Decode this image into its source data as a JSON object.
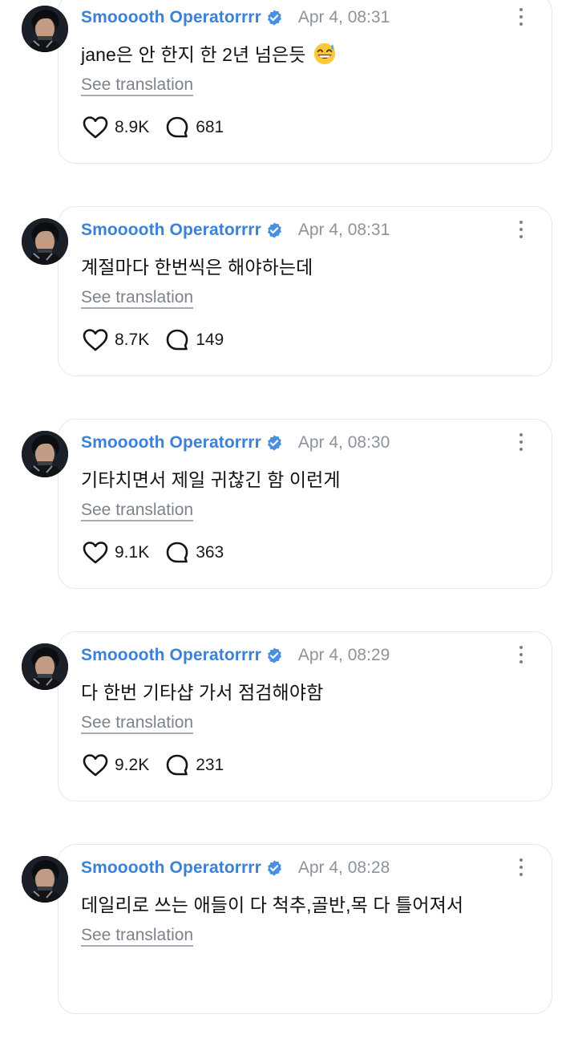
{
  "posts": [
    {
      "author": "Smooooth Operatorrrr",
      "timestamp": "Apr 4, 08:31",
      "text": "jane은 안 한지 한 2년 넘은듯",
      "emoji": "grinning-sweat-emoji",
      "translate_label": "See translation",
      "likes": "8.9K",
      "replies": "681"
    },
    {
      "author": "Smooooth Operatorrrr",
      "timestamp": "Apr 4, 08:31",
      "text": "계절마다 한번씩은 해야하는데",
      "translate_label": "See translation",
      "likes": "8.7K",
      "replies": "149"
    },
    {
      "author": "Smooooth Operatorrrr",
      "timestamp": "Apr 4, 08:30",
      "text": "기타치면서 제일 귀찮긴 함 이런게",
      "translate_label": "See translation",
      "likes": "9.1K",
      "replies": "363"
    },
    {
      "author": "Smooooth Operatorrrr",
      "timestamp": "Apr 4, 08:29",
      "text": "다 한번 기타샵 가서 점검해야함",
      "translate_label": "See translation",
      "likes": "9.2K",
      "replies": "231"
    },
    {
      "author": "Smooooth Operatorrrr",
      "timestamp": "Apr 4, 08:28",
      "text": "데일리로 쓰는 애들이 다 척추,골반,목 다 틀어져서",
      "translate_label": "See translation"
    }
  ],
  "icons": {
    "verified": "verified-badge-icon",
    "like": "heart-icon",
    "reply": "speech-bubble-icon",
    "more": "more-options-icon"
  },
  "colors": {
    "author": "#3b82d6",
    "verified": "#4a90e2",
    "timestamp": "#8c939c",
    "card_border": "#e3e7ee",
    "translation": "#7c838c"
  }
}
